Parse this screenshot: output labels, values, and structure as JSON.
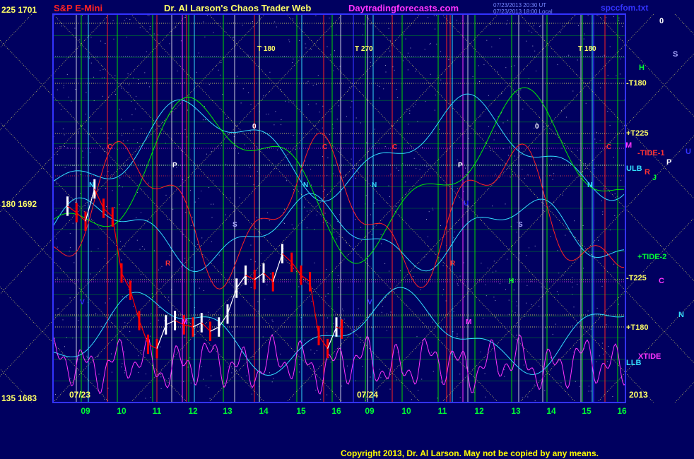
{
  "header": {
    "instrument": "S&P E-Mini",
    "title": "Dr. Al Larson's Chaos Trader Web",
    "site": "Daytradingforecasts.com",
    "timestamp_line1": "07/23/2013 20:30 UT",
    "timestamp_line2": "07/23/2013 18:00 Local",
    "file": "spccfom.txt"
  },
  "y_axis": {
    "top_label": "225  1701",
    "mid_label": "180  1692",
    "bottom_label": "135  1683"
  },
  "dates": {
    "day1": "07/23",
    "day2": "07/24",
    "year": "2013"
  },
  "x_ticks": [
    "09",
    "10",
    "11",
    "12",
    "13",
    "14",
    "15",
    "16",
    "09",
    "10",
    "11",
    "12",
    "13",
    "14",
    "15",
    "16"
  ],
  "right_labels": [
    {
      "text": "0",
      "color": "#ffffff"
    },
    {
      "text": "S",
      "color": "#aaaaff"
    },
    {
      "text": "H",
      "color": "#00ff33"
    },
    {
      "text": "-T180",
      "color": "#ffff66"
    },
    {
      "text": "+T225",
      "color": "#ffff66"
    },
    {
      "text": "M",
      "color": "#ff33ff"
    },
    {
      "text": "-TIDE-1",
      "color": "#ff3333"
    },
    {
      "text": "U",
      "color": "#3333ff"
    },
    {
      "text": "P",
      "color": "#ffffff"
    },
    {
      "text": "ULB",
      "color": "#33ddff"
    },
    {
      "text": "R",
      "color": "#ff3333"
    },
    {
      "text": "J",
      "color": "#00ff33"
    },
    {
      "text": "+TIDE-2",
      "color": "#00ff33"
    },
    {
      "text": "-T225",
      "color": "#ffff66"
    },
    {
      "text": "C",
      "color": "#ff33ff"
    },
    {
      "text": "N",
      "color": "#33ddff"
    },
    {
      "text": "+T180",
      "color": "#ffff66"
    },
    {
      "text": "XTIDE",
      "color": "#ff33ff"
    },
    {
      "text": "LLB",
      "color": "#33ddff"
    }
  ],
  "top_markers": [
    {
      "text": "T   180",
      "color": "#ffff66"
    },
    {
      "text": "T   270",
      "color": "#ffff66"
    },
    {
      "text": "T   180",
      "color": "#ffff66"
    }
  ],
  "planet_letters": [
    {
      "text": "C",
      "color": "#ff3333"
    },
    {
      "text": "N",
      "color": "#33ddff"
    },
    {
      "text": "P",
      "color": "#ffffff"
    },
    {
      "text": "0",
      "color": "#ffffff"
    },
    {
      "text": "S",
      "color": "#aaaaff"
    },
    {
      "text": "R",
      "color": "#ff3333"
    },
    {
      "text": "M",
      "color": "#ff33ff"
    },
    {
      "text": "V",
      "color": "#3333ff"
    },
    {
      "text": "C",
      "color": "#ff3333"
    },
    {
      "text": "N",
      "color": "#33ddff"
    },
    {
      "text": "N",
      "color": "#33ddff"
    },
    {
      "text": "C",
      "color": "#ff3333"
    },
    {
      "text": "P",
      "color": "#ffffff"
    },
    {
      "text": "U",
      "color": "#3333ff"
    },
    {
      "text": "R",
      "color": "#ff3333"
    },
    {
      "text": "M",
      "color": "#ff33ff"
    },
    {
      "text": "S",
      "color": "#aaaaff"
    },
    {
      "text": "0",
      "color": "#ffffff"
    },
    {
      "text": "H",
      "color": "#00ff33"
    },
    {
      "text": "N",
      "color": "#33ddff"
    },
    {
      "text": "C",
      "color": "#ff3333"
    },
    {
      "text": "V",
      "color": "#3333ff"
    }
  ],
  "copyright": "Copyright 2013, Dr. Al Larson. May not be copied by any means.",
  "colors": {
    "background": "#000060",
    "frame": "#3333ff",
    "grid_green": "#00dd00",
    "price_up": "#ffffff",
    "price_down": "#ff0000",
    "tide1": "#ff2222",
    "tide2": "#00ee00",
    "xtide": "#ff33ff",
    "bands": "#33ddff",
    "fractal": "#ffff66"
  },
  "chart_data": {
    "type": "line",
    "title": "S&P E-Mini",
    "x_ticks": [
      "09",
      "10",
      "11",
      "12",
      "13",
      "14",
      "15",
      "16",
      "09",
      "10",
      "11",
      "12",
      "13",
      "14",
      "15",
      "16"
    ],
    "x_range": [
      "07/23 08:30",
      "07/24 16:10"
    ],
    "ylim": [
      1683,
      1701
    ],
    "y_ticks": [
      1683,
      1692,
      1701
    ],
    "y_tick_angles": [
      135,
      180,
      225
    ],
    "gridlines_price": [
      1683,
      1684,
      1685,
      1686,
      1687,
      1688,
      1689,
      1690,
      1691,
      1692,
      1693,
      1694,
      1695,
      1696,
      1697,
      1698,
      1699,
      1700,
      1701
    ],
    "series": [
      {
        "name": "S&P E-Mini",
        "color": "#ffffff",
        "x_hours": [
          8.5,
          8.75,
          9.0,
          9.25,
          9.5,
          9.75,
          10.0,
          10.25,
          10.5,
          10.75,
          11.0,
          11.25,
          11.5,
          11.75,
          12.0,
          12.25,
          12.5,
          12.75,
          13.0,
          13.25,
          13.5,
          13.75,
          14.0,
          14.25,
          14.5,
          14.75,
          15.0,
          15.25,
          15.5,
          15.75,
          16.0,
          16.15
        ],
        "values": [
          1692.1,
          1691.8,
          1691.4,
          1692.9,
          1692.0,
          1691.6,
          1689.0,
          1688.2,
          1686.8,
          1685.7,
          1685.5,
          1686.6,
          1686.8,
          1686.6,
          1686.5,
          1686.7,
          1686.3,
          1686.5,
          1687.1,
          1688.3,
          1688.9,
          1688.7,
          1689.0,
          1688.6,
          1689.9,
          1689.5,
          1688.9,
          1688.6,
          1686.1,
          1685.5,
          1686.5,
          1686.4
        ]
      },
      {
        "name": "TIDE-1",
        "color": "#ff2222",
        "style": "forecast"
      },
      {
        "name": "TIDE-2",
        "color": "#00ee00",
        "style": "forecast"
      },
      {
        "name": "XTIDE",
        "color": "#ff33ff",
        "style": "oscillator"
      },
      {
        "name": "ULB",
        "color": "#33ddff",
        "style": "band"
      },
      {
        "name": "LLB",
        "color": "#33ddff",
        "style": "band"
      }
    ]
  }
}
